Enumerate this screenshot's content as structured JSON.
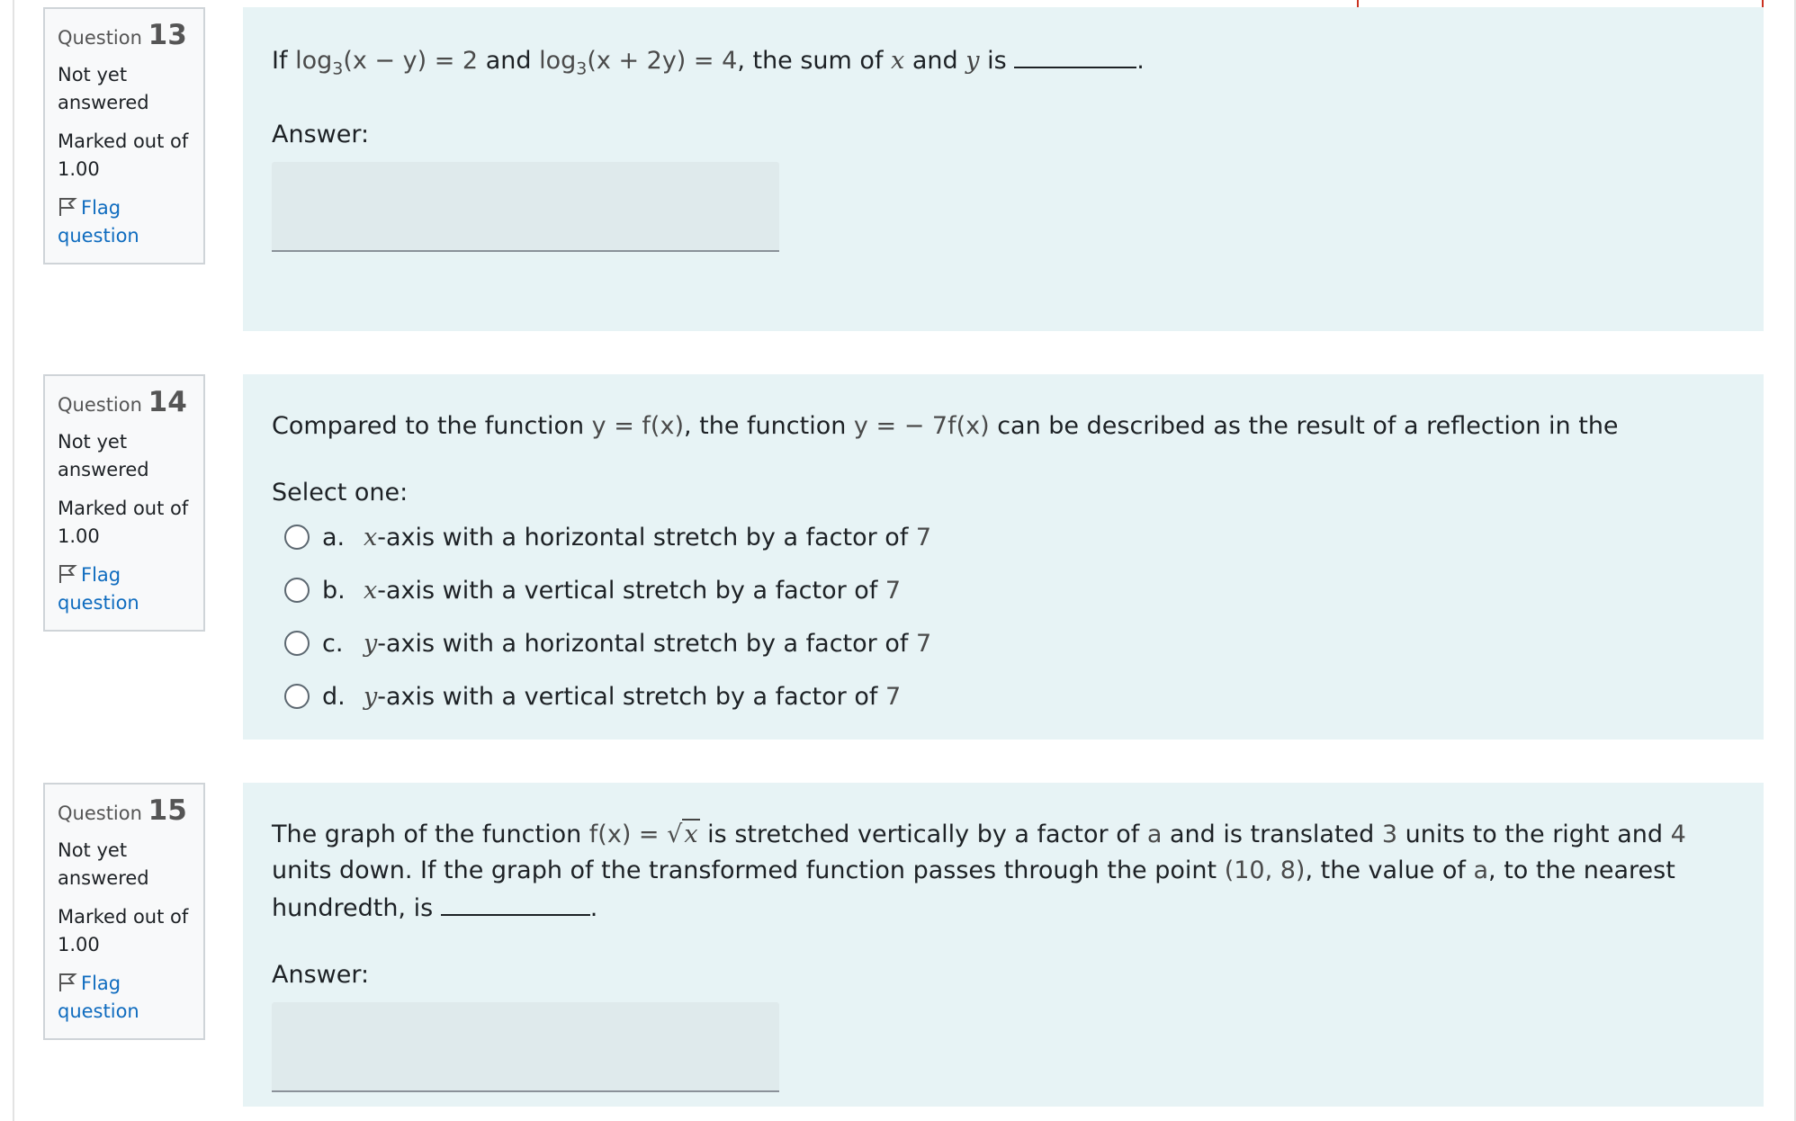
{
  "questions": [
    {
      "label": "Question",
      "number": "13",
      "state": "Not yet answered",
      "grade": "Marked out of 1.00",
      "flag_label": "Flag question",
      "text": {
        "p1": "If ",
        "log1": "log",
        "base1": "3",
        "arg1": "(x − y)",
        "eq1": " = 2",
        "p2": " and ",
        "log2": "log",
        "base2": "3",
        "arg2": "(x + 2y)",
        "eq2": " = 4",
        "p3": ", the sum of ",
        "x": "x",
        "p4": " and ",
        "y": "y",
        "p5": " is ",
        "p6": "."
      },
      "answer_label": "Answer:",
      "answer_value": ""
    },
    {
      "label": "Question",
      "number": "14",
      "state": "Not yet answered",
      "grade": "Marked out of 1.00",
      "flag_label": "Flag question",
      "text": {
        "p1": "Compared to the function ",
        "f1": "y = f(x)",
        "p2": ", the function ",
        "f2": "y = − 7f(x)",
        "p3": " can be described as the result of a reflection in the"
      },
      "select_label": "Select one:",
      "options": [
        {
          "letter": "a.",
          "axis": "x",
          "text": "-axis with a horizontal stretch by a factor of ",
          "factor": "7"
        },
        {
          "letter": "b.",
          "axis": "x",
          "text": "-axis with a vertical stretch by a factor of ",
          "factor": "7"
        },
        {
          "letter": "c.",
          "axis": "y",
          "text": "-axis with a horizontal stretch by a factor of ",
          "factor": "7"
        },
        {
          "letter": "d.",
          "axis": "y",
          "text": "-axis with a vertical stretch by a factor of ",
          "factor": "7"
        }
      ]
    },
    {
      "label": "Question",
      "number": "15",
      "state": "Not yet answered",
      "grade": "Marked out of 1.00",
      "flag_label": "Flag question",
      "text": {
        "p1": "The graph of the function ",
        "f1": "f(x) = ",
        "sqrt_arg": "x",
        "p2": " is stretched vertically by a factor of ",
        "a1": "a",
        "p3": " and is translated ",
        "n3": "3",
        "p4": " units to the right and ",
        "n4": "4",
        "p5": " units down. If the graph of the transformed function passes through the point ",
        "pt": "(10, 8)",
        "p6": ", the value of ",
        "a2": "a",
        "p7": ", to the nearest hundredth, is ",
        "p8": "."
      },
      "answer_label": "Answer:",
      "answer_value": ""
    }
  ]
}
